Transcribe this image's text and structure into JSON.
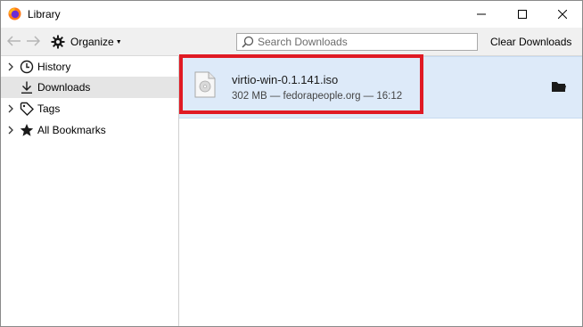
{
  "window": {
    "title": "Library"
  },
  "toolbar": {
    "organize_label": "Organize",
    "search_placeholder": "Search Downloads",
    "search_value": "",
    "clear_label": "Clear Downloads"
  },
  "sidebar": {
    "items": [
      {
        "label": "History",
        "icon": "clock-icon",
        "expandable": true,
        "selected": false
      },
      {
        "label": "Downloads",
        "icon": "download-arrow-icon",
        "expandable": false,
        "selected": true
      },
      {
        "label": "Tags",
        "icon": "tag-icon",
        "expandable": true,
        "selected": false
      },
      {
        "label": "All Bookmarks",
        "icon": "star-icon",
        "expandable": true,
        "selected": false
      }
    ]
  },
  "downloads": [
    {
      "filename": "virtio-win-0.1.141.iso",
      "status": "302 MB — fedorapeople.org — 16:12",
      "icon": "disc-image-file-icon",
      "action_icon": "folder-icon"
    }
  ],
  "colors": {
    "selection_bg": "#ddeaf9",
    "highlight_border": "#e01a24",
    "sidebar_selected_bg": "#e5e5e5"
  }
}
